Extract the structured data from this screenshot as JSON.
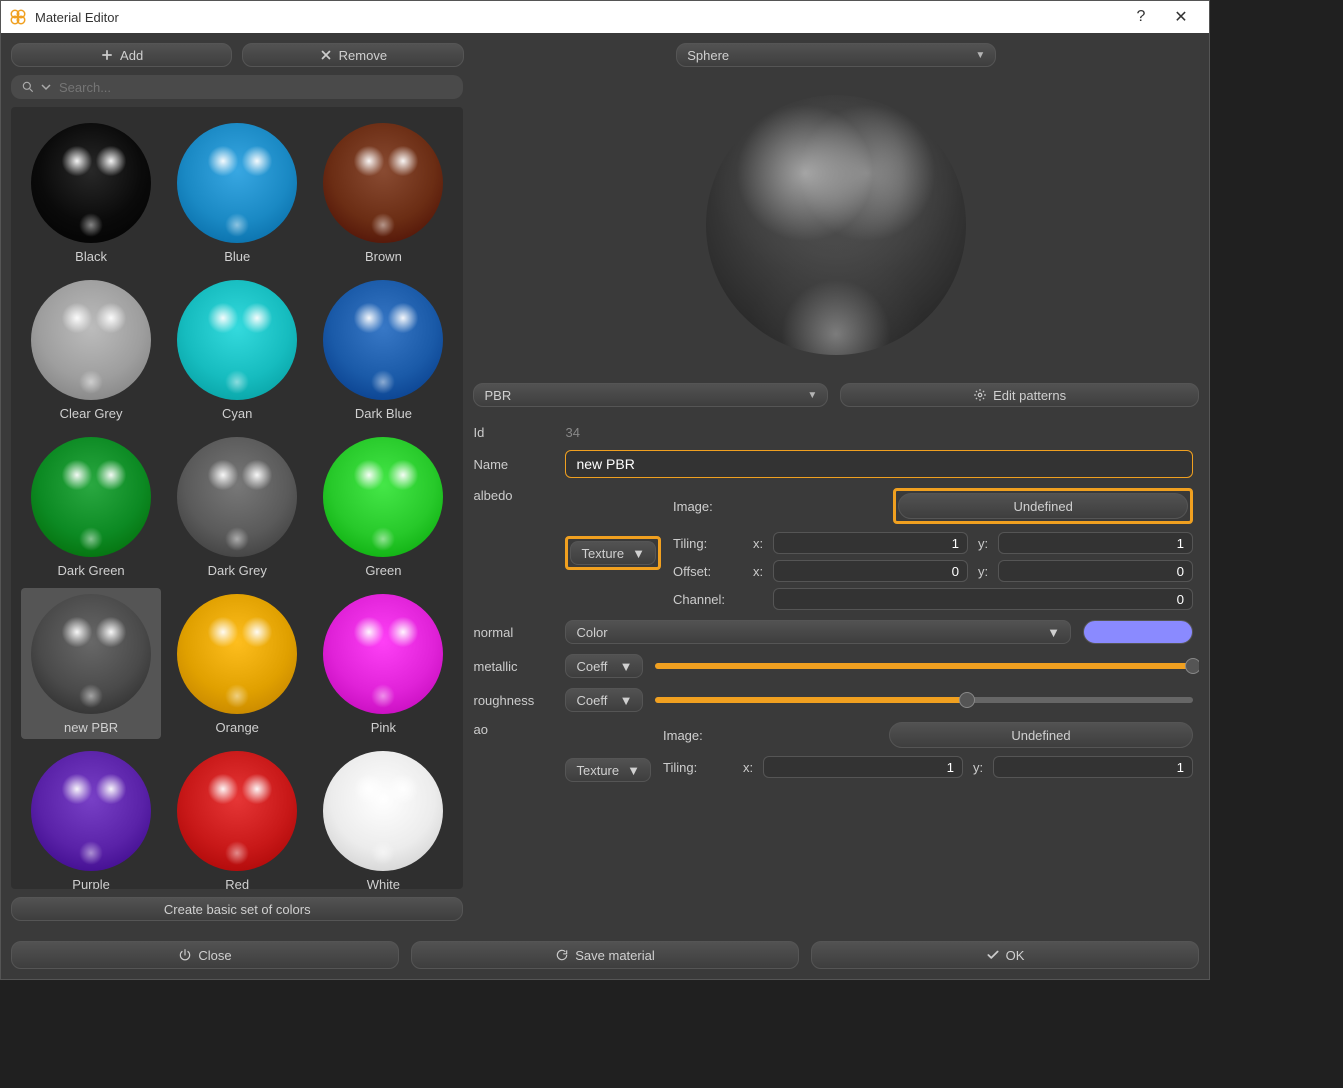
{
  "window": {
    "title": "Material Editor",
    "help": "?",
    "close": "✕"
  },
  "left": {
    "add": "Add",
    "remove": "Remove",
    "search_placeholder": "Search...",
    "create_basic": "Create basic set of colors",
    "materials": [
      {
        "label": "Black",
        "color": "#0a0a0a",
        "selected": false
      },
      {
        "label": "Blue",
        "color": "#1a89c4",
        "selected": false
      },
      {
        "label": "Brown",
        "color": "#6b2d14",
        "selected": false
      },
      {
        "label": "Clear Grey",
        "color": "#9e9e9e",
        "selected": false
      },
      {
        "label": "Cyan",
        "color": "#16bcbf",
        "selected": false
      },
      {
        "label": "Dark Blue",
        "color": "#1a5aa8",
        "selected": false
      },
      {
        "label": "Dark Green",
        "color": "#0c8a23",
        "selected": false
      },
      {
        "label": "Dark Grey",
        "color": "#5a5a5a",
        "selected": false
      },
      {
        "label": "Green",
        "color": "#27c92a",
        "selected": false
      },
      {
        "label": "new PBR",
        "color": "#4a4a4a",
        "selected": true
      },
      {
        "label": "Orange",
        "color": "#e0a000",
        "selected": false
      },
      {
        "label": "Pink",
        "color": "#e022d8",
        "selected": false
      },
      {
        "label": "Purple",
        "color": "#5a22a8",
        "selected": false
      },
      {
        "label": "Red",
        "color": "#c81818",
        "selected": false
      },
      {
        "label": "White",
        "color": "#ececec",
        "selected": false
      }
    ]
  },
  "right": {
    "preview_shape": "Sphere",
    "type": "PBR",
    "edit_patterns": "Edit patterns",
    "id_label": "Id",
    "id_value": "34",
    "name_label": "Name",
    "name_value": "new PBR",
    "albedo": {
      "label": "albedo",
      "mode": "Texture",
      "image_label": "Image:",
      "image_value": "Undefined",
      "tiling_label": "Tiling:",
      "offset_label": "Offset:",
      "channel_label": "Channel:",
      "x": "1",
      "y": "1",
      "ox": "0",
      "oy": "0",
      "channel": "0"
    },
    "normal": {
      "label": "normal",
      "mode": "Color",
      "color": "#8a8aff"
    },
    "metallic": {
      "label": "metallic",
      "mode": "Coeff",
      "value": 1.0
    },
    "roughness": {
      "label": "roughness",
      "mode": "Coeff",
      "value": 0.58
    },
    "ao": {
      "label": "ao",
      "mode": "Texture",
      "image_label": "Image:",
      "image_value": "Undefined",
      "tiling_label": "Tiling:",
      "x": "1",
      "y": "1"
    },
    "labels": {
      "x": "x:",
      "y": "y:"
    }
  },
  "footer": {
    "close": "Close",
    "save": "Save material",
    "ok": "OK"
  }
}
